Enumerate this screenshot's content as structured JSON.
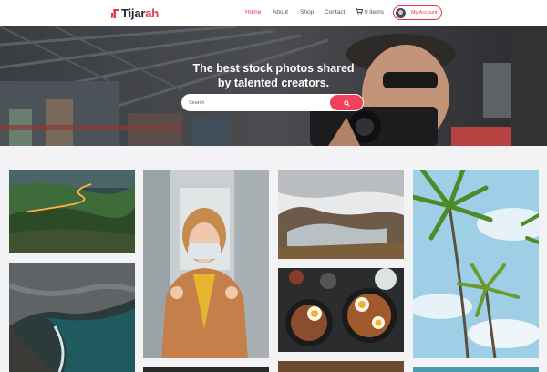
{
  "brand": {
    "name_part1": "Tijar",
    "name_part2": "ah",
    "accent_color": "#e8334a"
  },
  "nav": {
    "items": [
      {
        "label": "Home",
        "active": true
      },
      {
        "label": "About",
        "active": false
      },
      {
        "label": "Shop",
        "active": false
      },
      {
        "label": "Contact",
        "active": false
      }
    ],
    "cart_label": "0 items",
    "account_label": "My Account"
  },
  "hero": {
    "title_line1": "The best stock photos shared",
    "title_line2": "by talented creators.",
    "search_placeholder": "Search"
  },
  "icons": [
    "logo-mark-icon",
    "cart-icon",
    "avatar-icon",
    "search-icon"
  ]
}
